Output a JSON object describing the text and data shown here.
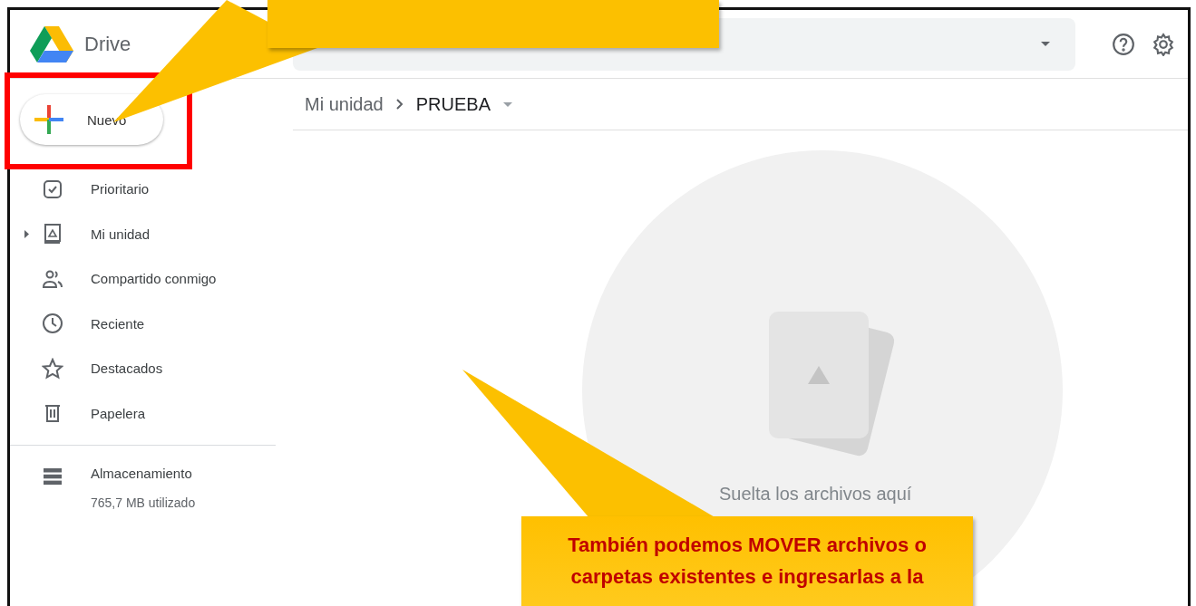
{
  "header": {
    "app_name": "Drive"
  },
  "new_button": {
    "label": "Nuevo",
    "highlighted": true
  },
  "sidebar": {
    "items": [
      {
        "label": "Prioritario",
        "kind": "priority",
        "expandable": false
      },
      {
        "label": "Mi unidad",
        "kind": "drive",
        "expandable": true
      },
      {
        "label": "Compartido conmigo",
        "kind": "shared",
        "expandable": false
      },
      {
        "label": "Reciente",
        "kind": "recent",
        "expandable": false
      },
      {
        "label": "Destacados",
        "kind": "starred",
        "expandable": false
      },
      {
        "label": "Papelera",
        "kind": "trash",
        "expandable": false
      }
    ],
    "storage": {
      "label": "Almacenamiento",
      "usage": "765,7 MB utilizado"
    }
  },
  "breadcrumb": [
    "Mi unidad",
    "PRUEBA"
  ],
  "drop_zone": {
    "text": "Suelta los archivos aquí"
  },
  "callout": {
    "lines": [
      "También podemos MOVER archivos o",
      "carpetas existentes e ingresarlas a la"
    ]
  }
}
